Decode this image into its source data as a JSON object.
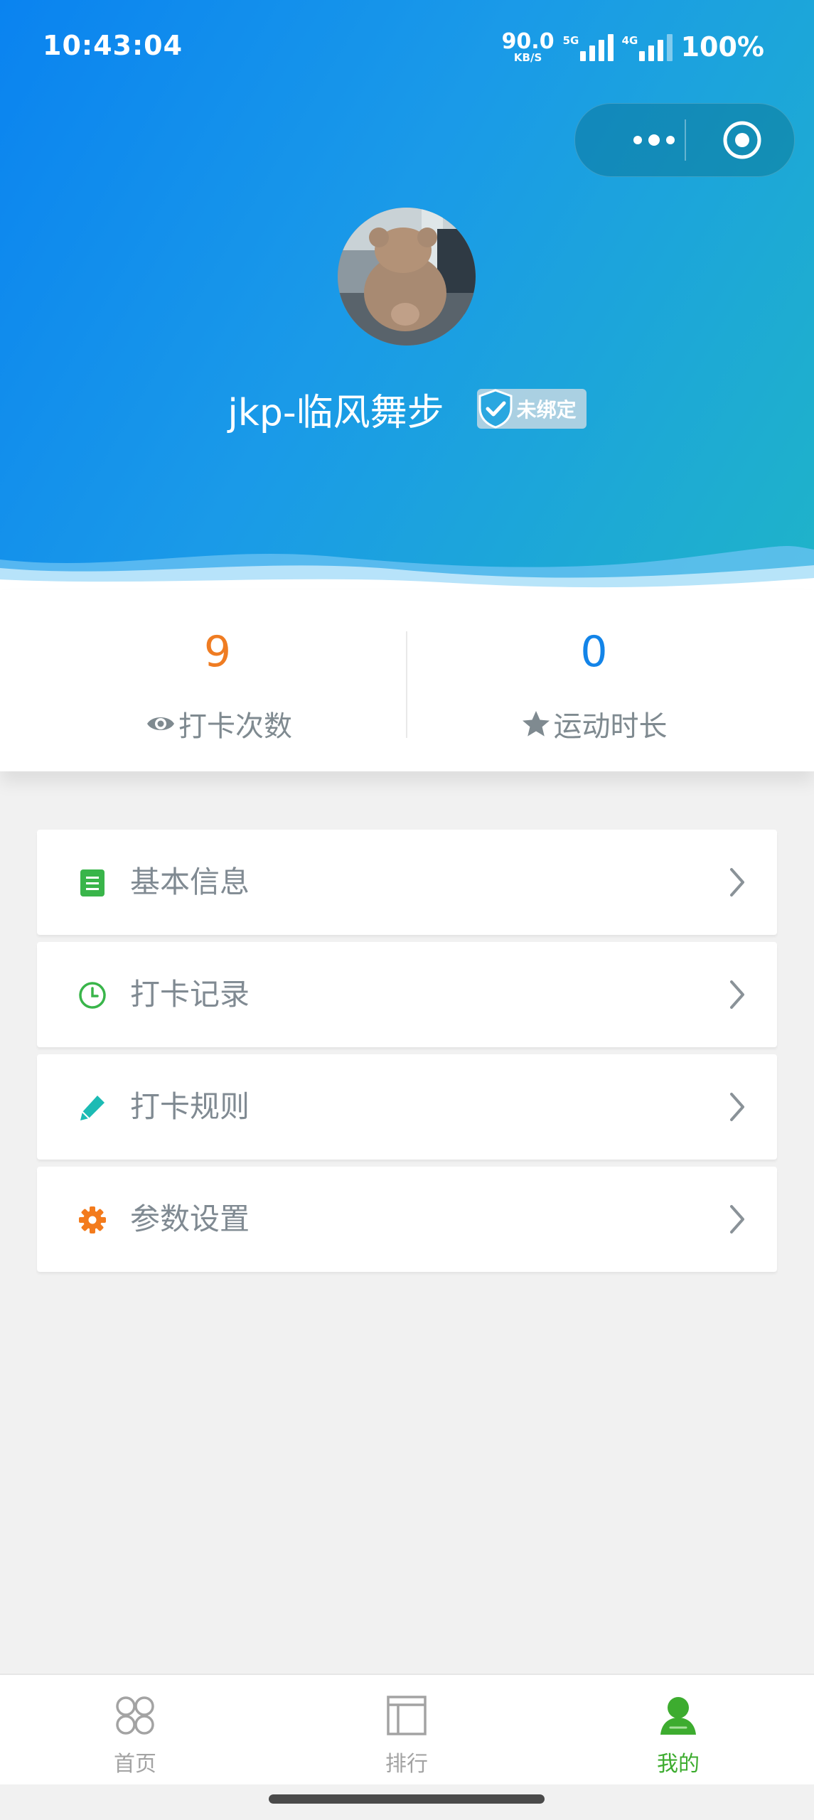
{
  "status_bar": {
    "time": "10:43:04",
    "net_speed_value": "90.0",
    "net_speed_unit": "KB/S",
    "signal_1_tag": "5G",
    "signal_2_tag": "4G",
    "battery": "100%"
  },
  "capsule": {
    "more_icon": "more-dots-icon",
    "close_icon": "target-icon"
  },
  "profile": {
    "username": "jkp-临风舞步",
    "bind_status": "未绑定",
    "avatar_icon": "bear-avatar"
  },
  "stats": {
    "checkin_count": "9",
    "checkin_label": "打卡次数",
    "exercise_value": "0",
    "exercise_label": "运动时长"
  },
  "menu": {
    "items": [
      {
        "label": "基本信息",
        "icon": "document-icon",
        "color": "#39b54a"
      },
      {
        "label": "打卡记录",
        "icon": "clock-icon",
        "color": "#39b54a"
      },
      {
        "label": "打卡规则",
        "icon": "pencil-icon",
        "color": "#1cbbb4"
      },
      {
        "label": "参数设置",
        "icon": "gear-icon",
        "color": "#f37b1d"
      }
    ]
  },
  "tabbar": {
    "items": [
      {
        "label": "首页",
        "icon": "grid-circles-icon"
      },
      {
        "label": "排行",
        "icon": "layout-icon"
      },
      {
        "label": "我的",
        "icon": "person-icon",
        "active": true
      }
    ]
  },
  "colors": {
    "header_gradient_start": "#0a83f0",
    "header_gradient_end": "#1fb3c9",
    "checkin_number": "#ef7c22",
    "exercise_number": "#1384e8",
    "tab_active": "#3dac2f"
  }
}
